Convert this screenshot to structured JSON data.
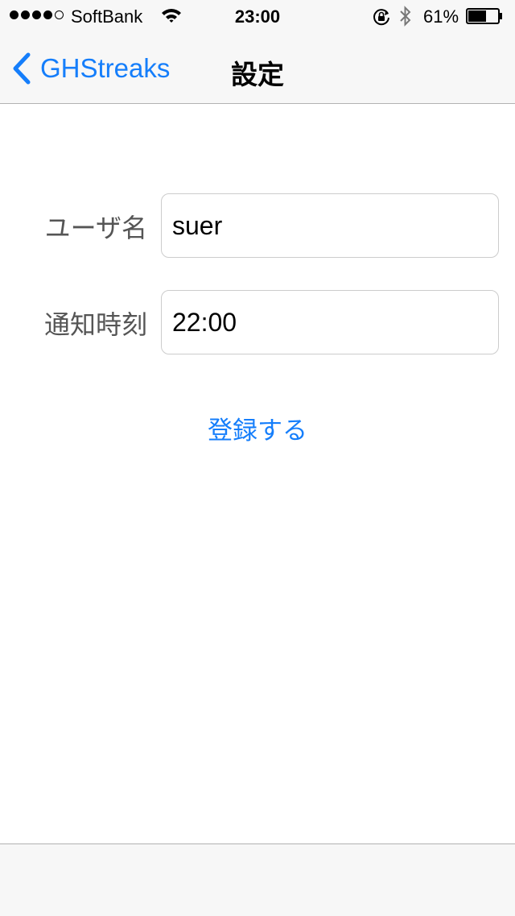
{
  "status_bar": {
    "signal_filled": 4,
    "signal_total": 5,
    "carrier": "SoftBank",
    "time": "23:00",
    "battery_percent": "61%",
    "battery_level": 0.61,
    "icons": [
      "wifi-icon",
      "rotation-lock-icon",
      "bluetooth-icon",
      "battery-icon"
    ]
  },
  "nav": {
    "back_label": "GHStreaks",
    "title": "設定"
  },
  "form": {
    "username_label": "ユーザ名",
    "username_value": "suer",
    "notify_time_label": "通知時刻",
    "notify_time_value": "22:00",
    "submit_label": "登録する"
  },
  "colors": {
    "accent": "#157efb",
    "bar_background": "#f7f7f7",
    "separator": "#b2b2b2",
    "label_text": "#555555",
    "field_border": "#cccccc"
  }
}
